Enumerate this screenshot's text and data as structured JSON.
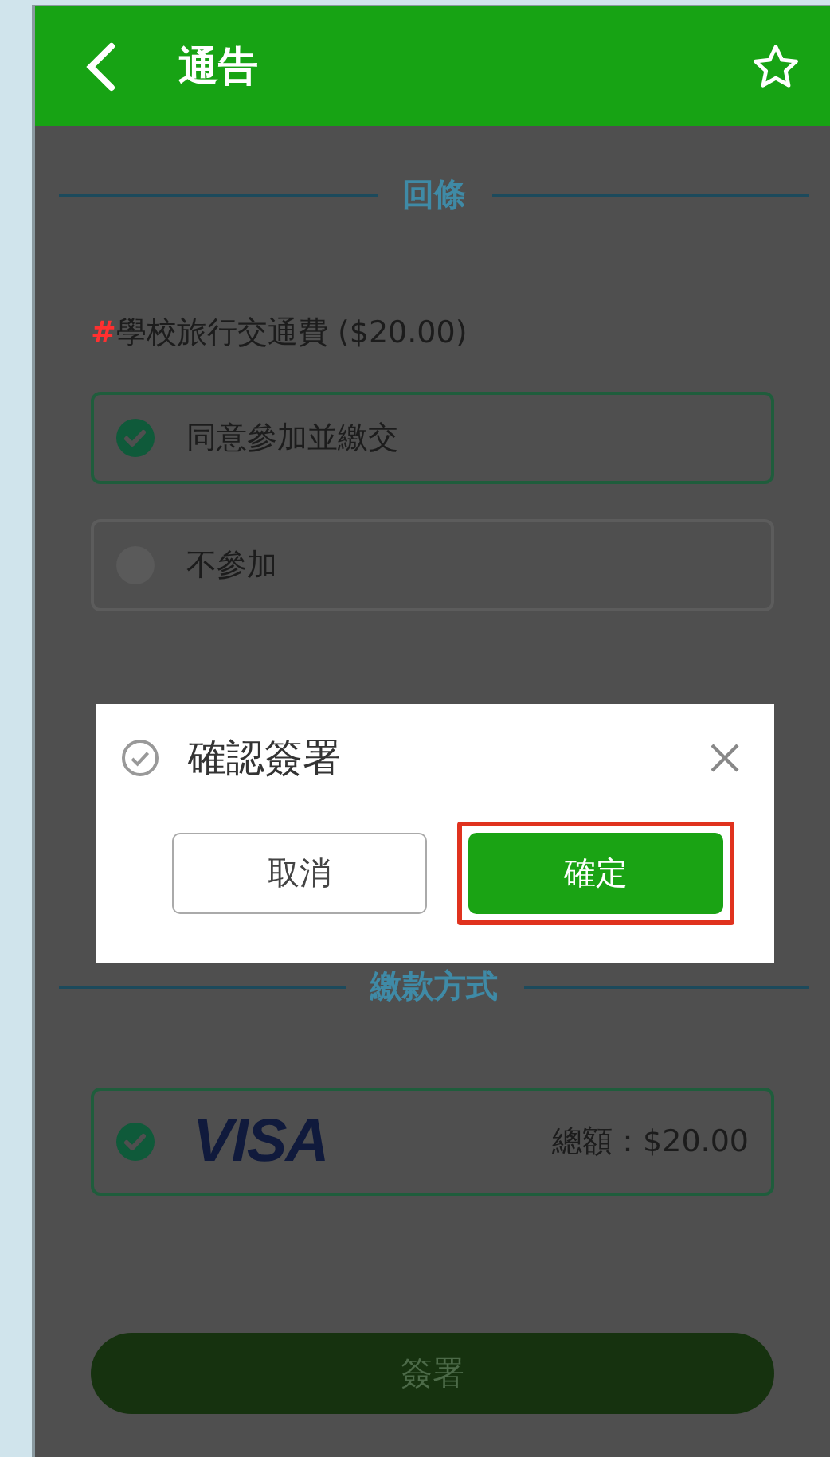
{
  "header": {
    "title": "通告"
  },
  "reply_section": {
    "heading": "回條",
    "question_mark": "#",
    "question": "學校旅行交通費 ($20.00)",
    "options": [
      {
        "label": "同意參加並繳交",
        "selected": true
      },
      {
        "label": "不參加",
        "selected": false
      }
    ]
  },
  "payment_section": {
    "heading": "繳款方式",
    "method": {
      "brand": "VISA",
      "selected": true,
      "total": "總額：$20.00"
    }
  },
  "sign_button": {
    "label": "簽署",
    "disabled": true
  },
  "dialog": {
    "title": "確認簽署",
    "buttons": [
      {
        "label": "取消",
        "kind": "secondary",
        "highlighted": false
      },
      {
        "label": "確定",
        "kind": "primary",
        "highlighted": true
      }
    ]
  }
}
